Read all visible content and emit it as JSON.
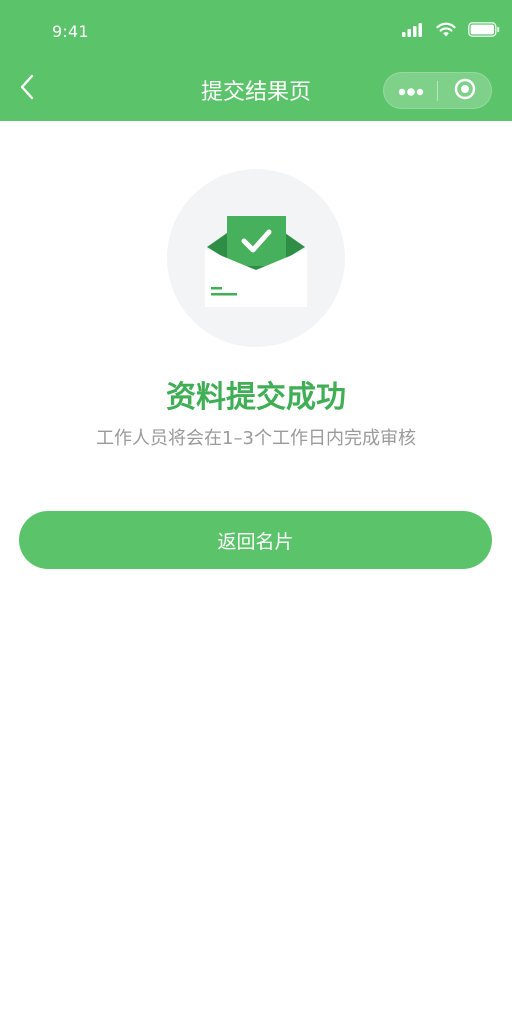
{
  "status_bar": {
    "time": "9:41"
  },
  "nav": {
    "title": "提交结果页",
    "back_icon": "chevron-left-icon",
    "more_icon": "more-dots-icon",
    "close_icon": "target-circle-icon"
  },
  "result": {
    "icon": "envelope-check-icon",
    "title": "资料提交成功",
    "description": "工作人员将会在1–3个工作日内完成审核"
  },
  "actions": {
    "back_to_card_label": "返回名片"
  },
  "colors": {
    "brand_green": "#5bc46a",
    "title_green": "#3fae55",
    "desc_gray": "#9a9a9a",
    "illustration_bg": "#f3f4f6"
  }
}
